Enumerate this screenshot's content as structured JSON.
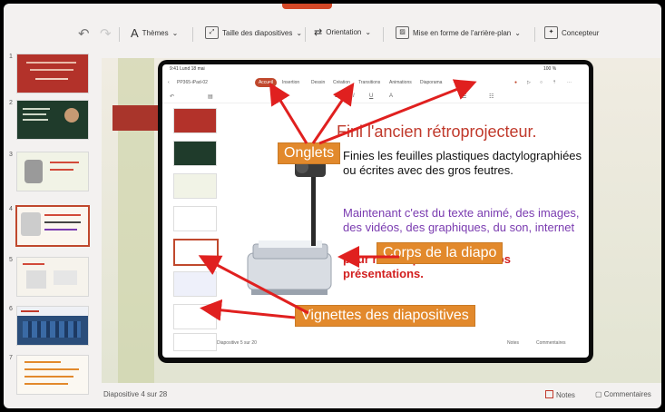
{
  "toolbar": {
    "themes": "Thèmes",
    "slide_size": "Taille des diapositives",
    "orientation": "Orientation",
    "background": "Mise en forme de l'arrière-plan",
    "designer": "Concepteur"
  },
  "sidebar": {
    "items": [
      {
        "num": "1"
      },
      {
        "num": "2"
      },
      {
        "num": "3"
      },
      {
        "num": "4"
      },
      {
        "num": "5"
      },
      {
        "num": "6"
      },
      {
        "num": "7"
      }
    ]
  },
  "ipad": {
    "time": "9:41  Lund 18 mai",
    "battery": "100 %",
    "file_name": "PP365-iPad-02",
    "tabs": [
      "Accueil",
      "Insertion",
      "Dessin",
      "Création",
      "Transitions",
      "Animations",
      "Diaporama"
    ],
    "footer_left": "Diapositive 5 sur 20",
    "footer_notes": "Notes",
    "footer_comments": "Commentaires"
  },
  "slide": {
    "title": "Fini l'ancien rétroprojecteur.",
    "para_black": "Finies les feuilles plastiques dactylographiées ou écrites avec des gros feutres.",
    "para_purple": "Maintenant c'est du texte animé, des images, des vidéos, des graphiques, du son, internet",
    "para_red": "pour rendre plus vivantes vos présentations."
  },
  "callouts": {
    "tabs": "Onglets",
    "body": "Corps de la diapo",
    "thumbnails": "Vignettes des diapositives"
  },
  "status": {
    "slide_count": "Diapositive 4 sur 28",
    "notes": "Notes",
    "comments": "Commentaires"
  },
  "colors": {
    "accent": "#c0482d",
    "callout": "#e2892c",
    "arrow": "#e0201f"
  }
}
